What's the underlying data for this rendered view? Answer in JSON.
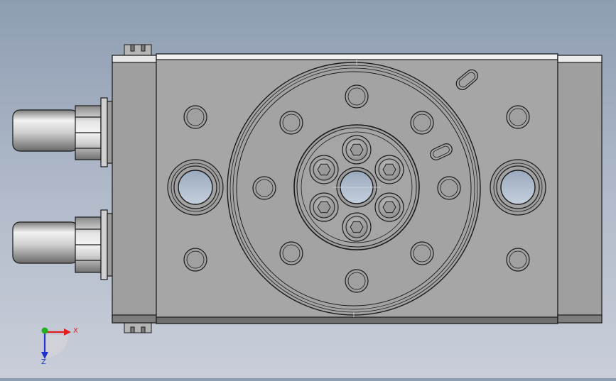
{
  "viewport": {
    "background_top": "#8e9db2",
    "background_bottom": "#c9ced9"
  },
  "part": {
    "body_color": "#a4a4a4",
    "end_cap_color": "#9d9d9d",
    "edge_color": "#1a1a1a",
    "bore_color": "#b7c4d4",
    "fitting_color": "#c8c8c8"
  },
  "triad": {
    "x_label": "X",
    "z_label": "Z",
    "x_color": "#e02020",
    "y_color": "#20b020",
    "z_color": "#2030d0"
  }
}
